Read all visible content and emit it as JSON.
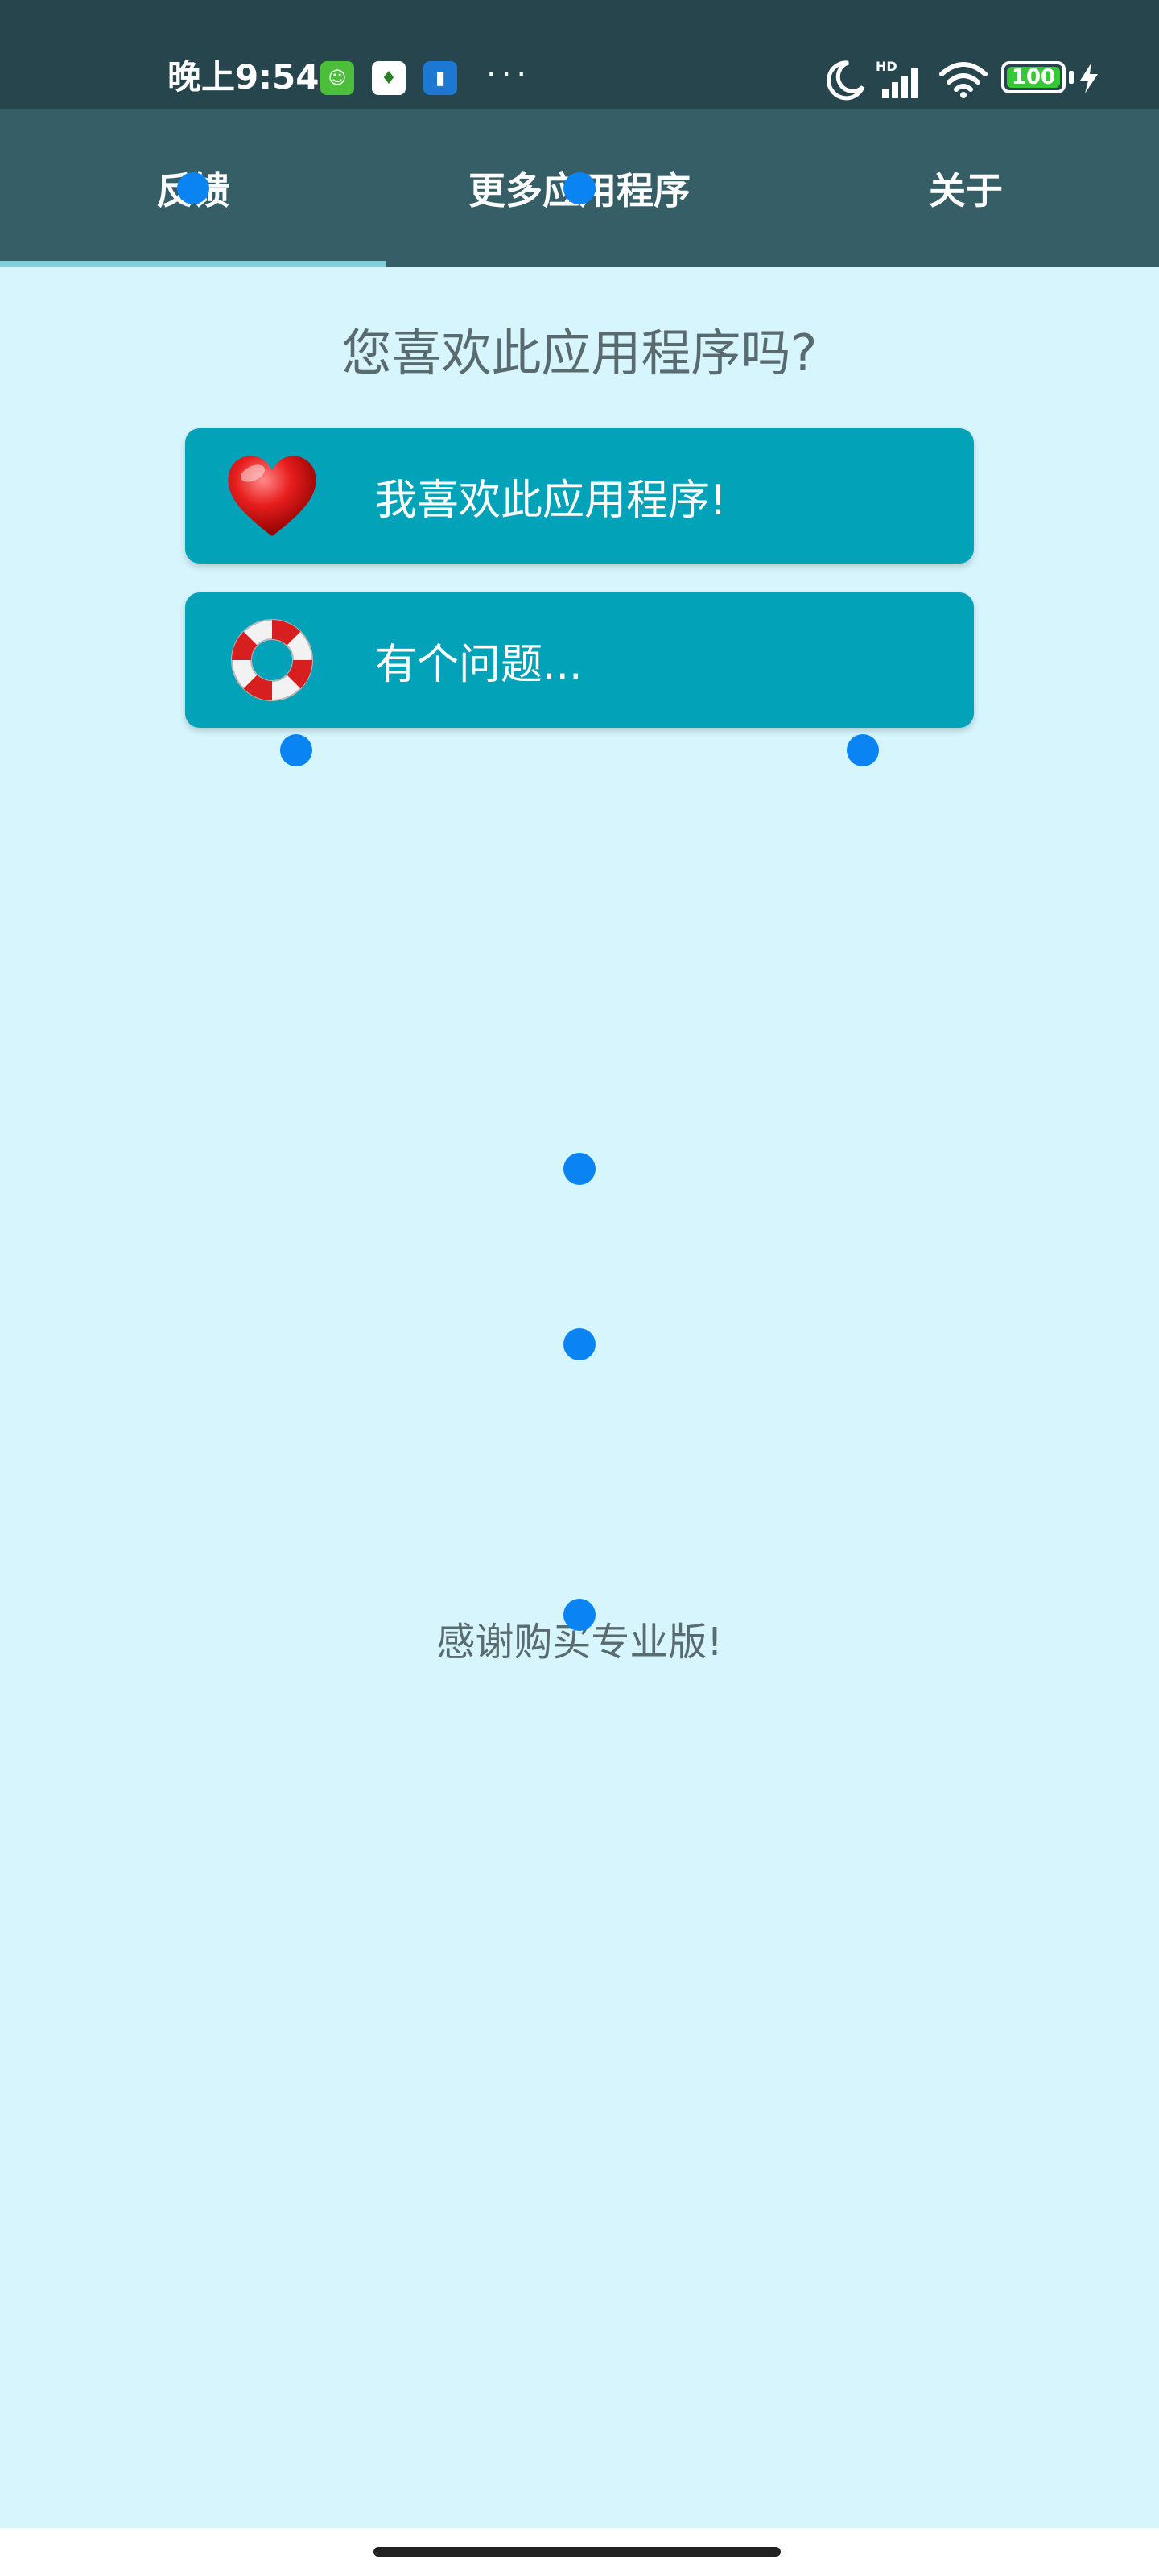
{
  "status_bar": {
    "time": "晚上9:54",
    "more": "···",
    "battery": "100",
    "network": "HD"
  },
  "tabs": [
    {
      "label": "反馈",
      "selected": true
    },
    {
      "label": "更多应用程序",
      "selected": false
    },
    {
      "label": "关于",
      "selected": false
    }
  ],
  "content": {
    "question": "您喜欢此应用程序吗?",
    "like_button": "我喜欢此应用程序!",
    "problem_button": "有个问题...",
    "thanks": "感谢购买专业版!"
  },
  "colors": {
    "status_bar": "#27454d",
    "tab_bar": "#355e66",
    "tab_indicator": "#7fd1dc",
    "background": "#d6f5fd",
    "button": "#02a3b8",
    "touch_dot": "#0a84f2"
  }
}
